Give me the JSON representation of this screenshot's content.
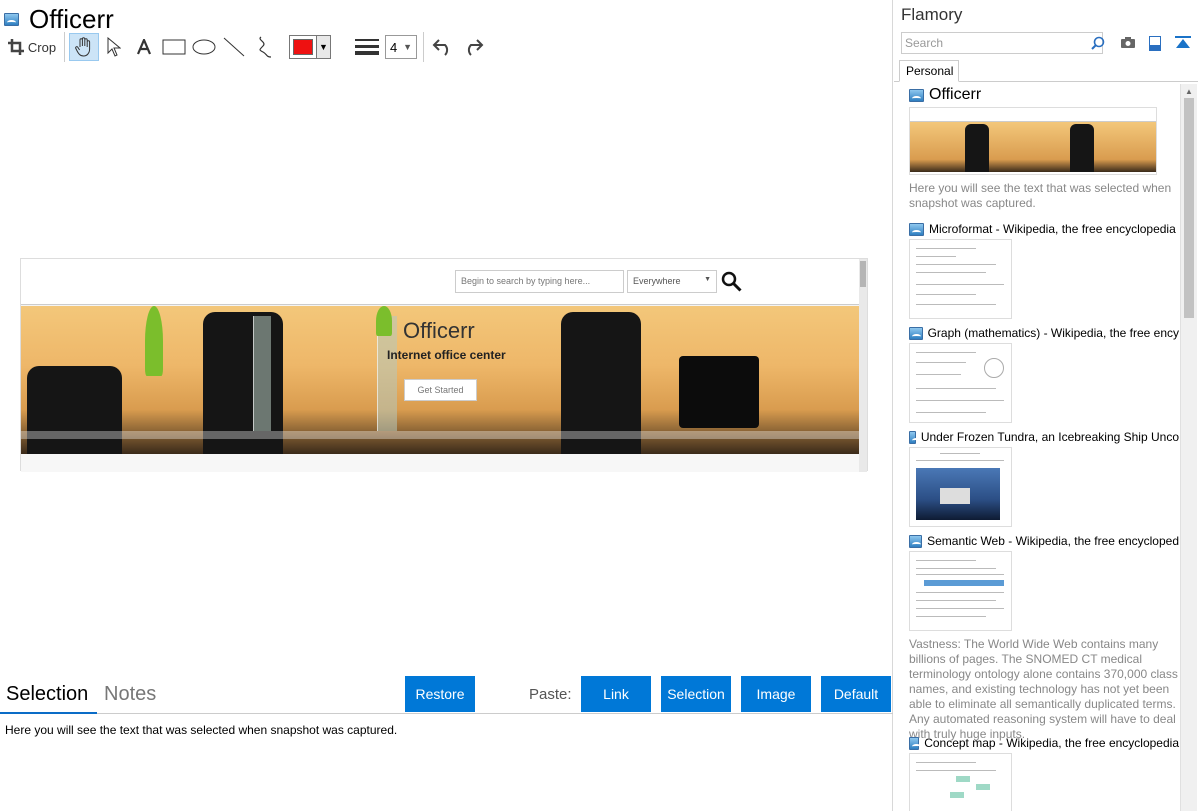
{
  "document": {
    "title": "Officerr"
  },
  "toolbar": {
    "crop_label": "Crop",
    "line_width": "4",
    "color": "#ee1111"
  },
  "snapshot": {
    "search_placeholder": "Begin to search by typing here...",
    "where_label": "Everywhere",
    "hero_title": "Officerr",
    "hero_subtitle": "Internet office center",
    "hero_button": "Get Started"
  },
  "bottom": {
    "tabs": [
      "Selection",
      "Notes"
    ],
    "restore_label": "Restore",
    "paste_label": "Paste:",
    "paste_buttons": [
      "Link",
      "Selection",
      "Image",
      "Default"
    ],
    "selection_text": "Here you will see the text that was selected when snapshot was captured."
  },
  "sidebar": {
    "app_title": "Flamory",
    "search_placeholder": "Search",
    "tab": "Personal",
    "items": [
      {
        "title": "Officerr",
        "desc": "Here you will see the text that was selected when snapshot was captured."
      },
      {
        "title": "Microformat - Wikipedia, the free encyclopedia",
        "desc": ""
      },
      {
        "title": "Graph (mathematics) - Wikipedia, the free ency",
        "desc": ""
      },
      {
        "title": "Under Frozen Tundra, an Icebreaking Ship Unco",
        "desc": ""
      },
      {
        "title": "Semantic Web - Wikipedia, the free encycloped",
        "desc": "Vastness: The World Wide Web contains many billions of pages. The SNOMED CT medical terminology ontology alone contains 370,000 class names, and existing technology has not yet been able to eliminate all semantically duplicated terms. Any automated reasoning system will have to deal with truly huge inputs."
      },
      {
        "title": "Concept map - Wikipedia, the free encyclopedia",
        "desc": ""
      }
    ]
  },
  "colors": {
    "accent": "#0078d7",
    "tab_underline": "#0a6cc7"
  }
}
